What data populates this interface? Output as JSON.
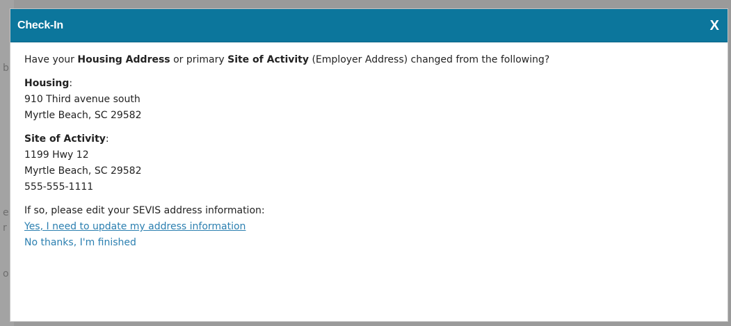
{
  "background": {
    "fragments": [
      "b",
      "e",
      "r",
      "o"
    ]
  },
  "dialog": {
    "title": "Check-In",
    "close_label": "X",
    "question": {
      "prefix": "Have your ",
      "housing_label": "Housing Address",
      "middle": " or primary ",
      "site_label": "Site of Activity",
      "suffix": " (Employer Address) changed from the following?"
    },
    "housing": {
      "label": "Housing",
      "colon": ":",
      "lines": [
        "910 Third avenue south",
        "Myrtle Beach, SC 29582"
      ]
    },
    "site": {
      "label": "Site of Activity",
      "colon": ":",
      "lines": [
        "1199 Hwy 12",
        "Myrtle Beach, SC 29582",
        "555-555-1111"
      ]
    },
    "instruction": "If so, please edit your SEVIS address information:",
    "update_link": "Yes, I need to update my address information",
    "finished_link": "No thanks, I'm finished"
  },
  "colors": {
    "titlebar": "#0c769c",
    "link": "#2b7fb0",
    "text": "#222222"
  }
}
